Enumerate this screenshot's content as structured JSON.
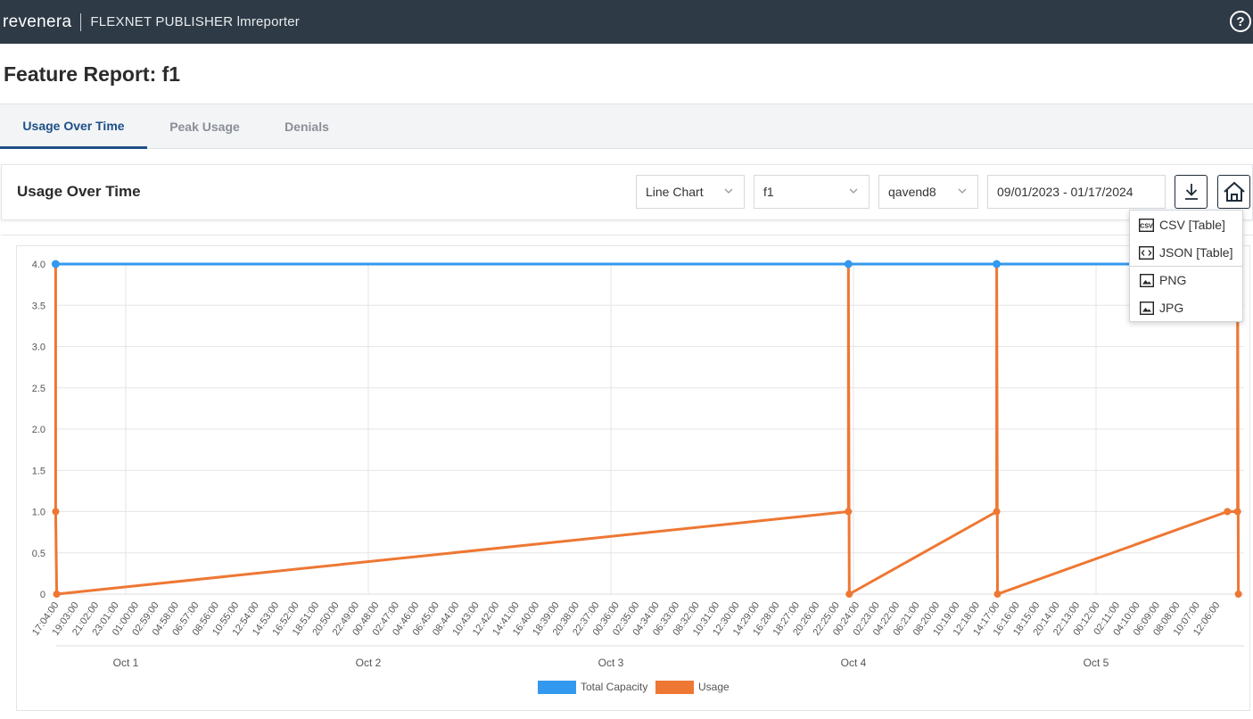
{
  "header": {
    "brand": "revenera",
    "product": "FLEXNET PUBLISHER lmreporter",
    "help_symbol": "?"
  },
  "page": {
    "title": "Feature Report: f1"
  },
  "tabs": [
    {
      "label": "Usage Over Time",
      "active": true
    },
    {
      "label": "Peak Usage",
      "active": false
    },
    {
      "label": "Denials",
      "active": false
    }
  ],
  "panel": {
    "title": "Usage Over Time",
    "chart_type": "Line Chart",
    "feature": "f1",
    "vendor": "qavend8",
    "date_range": "09/01/2023 - 01/17/2024"
  },
  "download_menu": {
    "items": [
      {
        "label": "CSV [Table]",
        "icon": "csv-icon"
      },
      {
        "label": "JSON [Table]",
        "icon": "code-icon"
      },
      {
        "label": "PNG",
        "icon": "image-icon"
      },
      {
        "label": "JPG",
        "icon": "image-icon"
      }
    ]
  },
  "colors": {
    "capacity": "#3399ee",
    "usage": "#ee7733",
    "topbar": "#2e3a46",
    "accent": "#1d4f86"
  },
  "chart_data": {
    "type": "line",
    "ylim": [
      0,
      4.0
    ],
    "y_ticks": [
      "0",
      "0.5",
      "1.0",
      "1.5",
      "2.0",
      "2.5",
      "3.0",
      "3.5",
      "4.0"
    ],
    "x_tick_labels": [
      "17:04:00",
      "19:03:00",
      "21:02:00",
      "23:01:00",
      "01:00:00",
      "02:59:00",
      "04:58:00",
      "06:57:00",
      "08:56:00",
      "10:55:00",
      "12:54:00",
      "14:53:00",
      "16:52:00",
      "18:51:00",
      "20:50:00",
      "22:49:00",
      "00:48:00",
      "02:47:00",
      "04:46:00",
      "06:45:00",
      "08:44:00",
      "10:43:00",
      "12:42:00",
      "14:41:00",
      "16:40:00",
      "18:39:00",
      "20:38:00",
      "22:37:00",
      "00:36:00",
      "02:35:00",
      "04:34:00",
      "06:33:00",
      "08:32:00",
      "10:31:00",
      "12:30:00",
      "14:29:00",
      "16:28:00",
      "18:27:00",
      "20:26:00",
      "22:25:00",
      "00:24:00",
      "02:23:00",
      "04:22:00",
      "06:21:00",
      "08:20:00",
      "10:19:00",
      "12:18:00",
      "14:17:00",
      "16:16:00",
      "18:15:00",
      "20:14:00",
      "22:13:00",
      "00:12:00",
      "02:11:00",
      "04:10:00",
      "06:09:00",
      "08:08:00",
      "10:07:00",
      "12:06:00"
    ],
    "day_labels": [
      "Oct 1",
      "Oct 2",
      "Oct 3",
      "Oct 4",
      "Oct 5"
    ],
    "legend": [
      "Total Capacity",
      "Usage"
    ],
    "legend_position": "bottom",
    "grid": true,
    "series": [
      {
        "name": "Total Capacity",
        "points": [
          [
            "Sep 30 17:04",
            4.0
          ],
          [
            "Oct 3 23:30",
            4.0
          ],
          [
            "Oct 4 14:10",
            4.0
          ],
          [
            "Oct 5 14:00",
            4.0
          ]
        ]
      },
      {
        "name": "Usage",
        "points": [
          [
            "Sep 30 17:04",
            4.0
          ],
          [
            "Sep 30 17:04",
            1.0
          ],
          [
            "Sep 30 17:10",
            0
          ],
          [
            "Oct 3 23:30",
            1.0
          ],
          [
            "Oct 3 23:30",
            4.0
          ],
          [
            "Oct 3 23:35",
            0
          ],
          [
            "Oct 4 14:10",
            1.0
          ],
          [
            "Oct 4 14:10",
            4.0
          ],
          [
            "Oct 4 14:15",
            0
          ],
          [
            "Oct 5 13:00",
            1.0
          ],
          [
            "Oct 5 14:00",
            1.0
          ],
          [
            "Oct 5 14:00",
            4.0
          ],
          [
            "Oct 5 14:05",
            0
          ]
        ]
      }
    ]
  }
}
